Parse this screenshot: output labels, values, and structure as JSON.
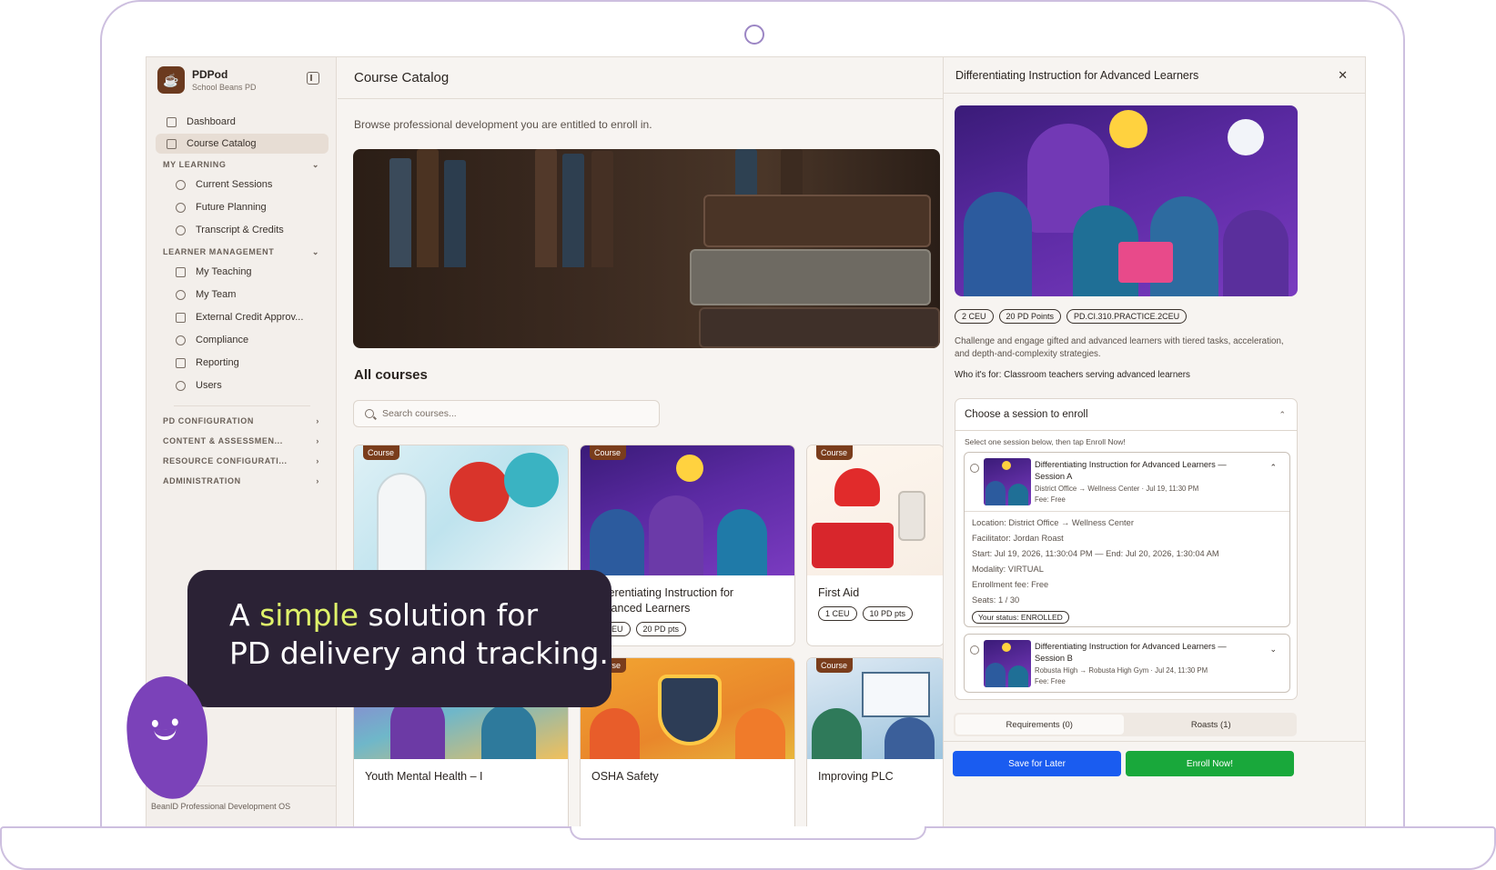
{
  "brand": {
    "name": "PDPod",
    "org": "School Beans PD"
  },
  "sidebar": {
    "top_items": [
      {
        "label": "Dashboard",
        "icon": "grid-icon"
      },
      {
        "label": "Course Catalog",
        "icon": "store-icon",
        "active": true
      }
    ],
    "my_learning": {
      "label": "MY LEARNING",
      "items": [
        {
          "label": "Current Sessions",
          "icon": "graduation-cap-icon"
        },
        {
          "label": "Future Planning",
          "icon": "route-icon"
        },
        {
          "label": "Transcript & Credits",
          "icon": "award-icon"
        }
      ]
    },
    "learner_management": {
      "label": "LEARNER MANAGEMENT",
      "items": [
        {
          "label": "My Teaching",
          "icon": "presentation-icon"
        },
        {
          "label": "My Team",
          "icon": "users-icon"
        },
        {
          "label": "External Credit Approv...",
          "icon": "clipboard-icon"
        },
        {
          "label": "Compliance",
          "icon": "shield-icon"
        },
        {
          "label": "Reporting",
          "icon": "bar-chart-icon"
        },
        {
          "label": "Users",
          "icon": "user-cog-icon"
        }
      ]
    },
    "collapsed_sections": [
      "PD CONFIGURATION",
      "CONTENT & ASSESSMEN...",
      "RESOURCE CONFIGURATI...",
      "ADMINISTRATION"
    ],
    "footer": "BeanID Professional Development OS"
  },
  "main": {
    "title": "Course Catalog",
    "subtitle": "Browse professional development you are entitled to enroll in.",
    "section_title": "All courses",
    "search_placeholder": "Search courses...",
    "cards": [
      {
        "tag": "Course",
        "title": "",
        "chips": []
      },
      {
        "tag": "Course",
        "title": "Differentiating Instruction for Advanced Learners",
        "chips": [
          "2 CEU",
          "20 PD pts"
        ]
      },
      {
        "tag": "Course",
        "title": "First Aid",
        "chips": [
          "1 CEU",
          "10 PD pts"
        ]
      },
      {
        "tag": "",
        "title": "Youth Mental Health – I",
        "chips": []
      },
      {
        "tag": "Course",
        "title": "OSHA Safety",
        "chips": []
      },
      {
        "tag": "Course",
        "title": "Improving PLC",
        "chips": []
      }
    ]
  },
  "panel": {
    "title": "Differentiating Instruction for Advanced Learners",
    "chips": [
      "2 CEU",
      "20 PD Points",
      "PD.CI.310.PRACTICE.2CEU"
    ],
    "description": "Challenge and engage gifted and advanced learners with tiered tasks, acceleration, and depth-and-complexity strategies.",
    "who_for": "Who it's for: Classroom teachers serving advanced learners",
    "session_heading": "Choose a session to enroll",
    "session_hint": "Select one session below, then tap Enroll Now!",
    "sessions": [
      {
        "title": "Differentiating Instruction for Advanced Learners — Session A",
        "meta": "District Office → Wellness Center · Jul 19, 11:30 PM",
        "fee": "Fee: Free",
        "details": [
          "Location: District Office → Wellness Center",
          "Facilitator: Jordan Roast",
          "Start: Jul 19, 2026, 11:30:04 PM — End: Jul 20, 2026, 1:30:04 AM",
          "Modality: VIRTUAL",
          "Enrollment fee: Free",
          "Seats: 1 / 30"
        ],
        "status": "Your status: ENROLLED"
      },
      {
        "title": "Differentiating Instruction for Advanced Learners — Session B",
        "meta": "Robusta High → Robusta High Gym · Jul 24, 11:30 PM",
        "fee": "Fee: Free"
      }
    ],
    "tabs": [
      "Requirements (0)",
      "Roasts (1)"
    ],
    "save_label": "Save for Later",
    "enroll_label": "Enroll Now!"
  },
  "callout": {
    "line1_a": "A ",
    "line1_hl": "simple",
    "line1_b": " solution for",
    "line2": "PD delivery and tracking."
  },
  "colors": {
    "accent_brown": "#7a3d1c",
    "save_blue": "#1a5cf0",
    "enroll_green": "#19a83b",
    "callout_bg": "#2b2235",
    "highlight": "#dff26a",
    "mascot": "#7b42b9"
  }
}
